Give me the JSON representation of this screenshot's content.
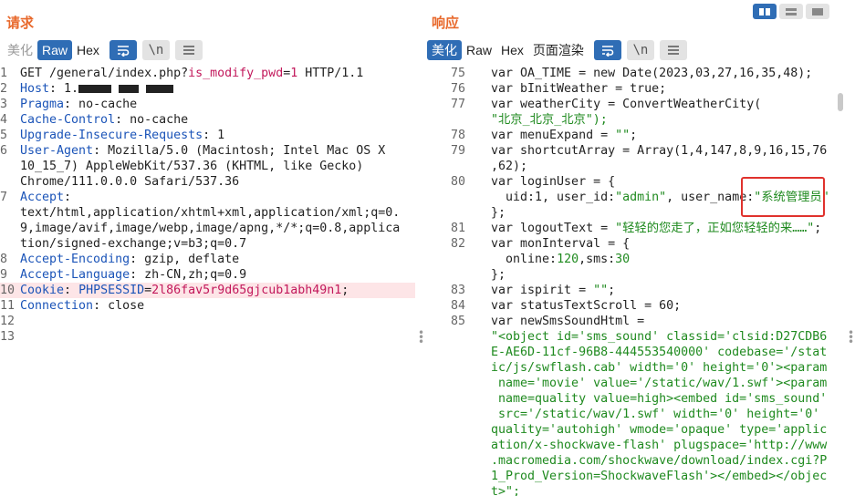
{
  "request": {
    "title": "请求",
    "tabs": [
      "美化",
      "Raw",
      "Hex"
    ],
    "active_tab": "Raw",
    "newline_label": "\\n",
    "lines": [
      {
        "n": "1",
        "parts": [
          {
            "t": "GET /general/index.php?",
            "c": "txt0"
          },
          {
            "t": "is_modify_pwd",
            "c": "v"
          },
          {
            "t": "=",
            "c": "txt0"
          },
          {
            "t": "1",
            "c": "v"
          },
          {
            "t": " HTTP/1.1",
            "c": "txt0"
          }
        ]
      },
      {
        "n": "2",
        "parts": [
          {
            "t": "Host",
            "c": "k"
          },
          {
            "t": ": ",
            "c": "txt0"
          },
          {
            "t": "1.",
            "c": "txt0"
          },
          {
            "mask": 36
          },
          {
            "t": " ",
            "c": "txt0"
          },
          {
            "mask": 22
          },
          {
            "t": " ",
            "c": "txt0"
          },
          {
            "mask": 30
          }
        ]
      },
      {
        "n": "3",
        "parts": [
          {
            "t": "Pragma",
            "c": "k"
          },
          {
            "t": ": no-cache",
            "c": "txt0"
          }
        ]
      },
      {
        "n": "4",
        "parts": [
          {
            "t": "Cache-Control",
            "c": "k"
          },
          {
            "t": ": no-cache",
            "c": "txt0"
          }
        ]
      },
      {
        "n": "5",
        "parts": [
          {
            "t": "Upgrade-Insecure-Requests",
            "c": "k"
          },
          {
            "t": ": 1",
            "c": "txt0"
          }
        ]
      },
      {
        "n": "6",
        "parts": [
          {
            "t": "User-Agent",
            "c": "k"
          },
          {
            "t": ": Mozilla/5.0 (Macintosh; Intel Mac OS X",
            "c": "txt0"
          }
        ]
      },
      {
        "n": "",
        "parts": [
          {
            "t": "10_15_7) AppleWebKit/537.36 (KHTML, like Gecko)",
            "c": "txt0"
          }
        ]
      },
      {
        "n": "",
        "parts": [
          {
            "t": "Chrome/111.0.0.0 Safari/537.36",
            "c": "txt0"
          }
        ]
      },
      {
        "n": "7",
        "parts": [
          {
            "t": "Accept",
            "c": "k"
          },
          {
            "t": ":",
            "c": "txt0"
          }
        ]
      },
      {
        "n": "",
        "parts": [
          {
            "t": "text/html,application/xhtml+xml,application/xml;q=0.",
            "c": "txt0"
          }
        ]
      },
      {
        "n": "",
        "parts": [
          {
            "t": "9,image/avif,image/webp,image/apng,*/*;q=0.8,applica",
            "c": "txt0"
          }
        ]
      },
      {
        "n": "",
        "parts": [
          {
            "t": "tion/signed-exchange;v=b3;q=0.7",
            "c": "txt0"
          }
        ]
      },
      {
        "n": "8",
        "parts": [
          {
            "t": "Accept-Encoding",
            "c": "k"
          },
          {
            "t": ": gzip, deflate",
            "c": "txt0"
          }
        ]
      },
      {
        "n": "9",
        "parts": [
          {
            "t": "Accept-Language",
            "c": "k"
          },
          {
            "t": ": zh-CN,zh;q=0.9",
            "c": "txt0"
          }
        ]
      },
      {
        "n": "10",
        "cur": true,
        "parts": [
          {
            "t": "Cookie",
            "c": "k"
          },
          {
            "t": ": ",
            "c": "txt0"
          },
          {
            "t": "PHPSESSID",
            "c": "k"
          },
          {
            "t": "=",
            "c": "txt0"
          },
          {
            "t": "2l86fav5r9d65gjcub1abh49n1",
            "c": "v"
          },
          {
            "t": ";",
            "c": "txt0"
          }
        ]
      },
      {
        "n": "11",
        "parts": [
          {
            "t": "Connection",
            "c": "k"
          },
          {
            "t": ": close",
            "c": "txt0"
          }
        ]
      },
      {
        "n": "12",
        "parts": []
      },
      {
        "n": "13",
        "parts": []
      }
    ]
  },
  "response": {
    "title": "响应",
    "tabs": [
      "美化",
      "Raw",
      "Hex",
      "页面渲染"
    ],
    "active_tab": "美化",
    "newline_label": "\\n",
    "lines": [
      {
        "n": "75",
        "parts": [
          {
            "t": "var OA_TIME = new Date(2023,03,27,16,35,48);",
            "c": "txt0"
          }
        ]
      },
      {
        "n": "76",
        "parts": [
          {
            "t": "var bInitWeather = true;",
            "c": "txt0"
          }
        ]
      },
      {
        "n": "77",
        "parts": [
          {
            "t": "var weatherCity = ConvertWeatherCity(",
            "c": "txt0"
          }
        ]
      },
      {
        "n": "",
        "parts": [
          {
            "t": "\"北京_北京_北京\");",
            "c": "s"
          }
        ]
      },
      {
        "n": "78",
        "parts": [
          {
            "t": "var menuExpand = ",
            "c": "txt0"
          },
          {
            "t": "\"\"",
            "c": "s"
          },
          {
            "t": ";",
            "c": "txt0"
          }
        ]
      },
      {
        "n": "79",
        "parts": [
          {
            "t": "var shortcutArray = Array(1,4,147,8,9,16,15,76",
            "c": "txt0"
          }
        ]
      },
      {
        "n": "",
        "parts": [
          {
            "t": ",62);",
            "c": "txt0"
          }
        ]
      },
      {
        "n": "80",
        "parts": [
          {
            "t": "var loginUser = {",
            "c": "txt0"
          }
        ]
      },
      {
        "n": "",
        "parts": [
          {
            "t": "  uid:1, user_id:",
            "c": "txt0"
          },
          {
            "t": "\"admin\"",
            "c": "s"
          },
          {
            "t": ", user_name:",
            "c": "txt0"
          },
          {
            "t": "\"系统管理员\"",
            "c": "s"
          }
        ]
      },
      {
        "n": "",
        "parts": [
          {
            "t": "};",
            "c": "txt0"
          }
        ]
      },
      {
        "n": "81",
        "parts": [
          {
            "t": "var logoutText = ",
            "c": "txt0"
          },
          {
            "t": "\"轻轻的您走了，正如您轻轻的来……\"",
            "c": "s"
          },
          {
            "t": ";",
            "c": "txt0"
          }
        ]
      },
      {
        "n": "82",
        "parts": [
          {
            "t": "var monInterval = {",
            "c": "txt0"
          }
        ]
      },
      {
        "n": "",
        "parts": [
          {
            "t": "  online:",
            "c": "txt0"
          },
          {
            "t": "120",
            "c": "s"
          },
          {
            "t": ",sms:",
            "c": "txt0"
          },
          {
            "t": "30",
            "c": "s"
          }
        ]
      },
      {
        "n": "",
        "parts": [
          {
            "t": "};",
            "c": "txt0"
          }
        ]
      },
      {
        "n": "83",
        "parts": [
          {
            "t": "var ispirit = ",
            "c": "txt0"
          },
          {
            "t": "\"\"",
            "c": "s"
          },
          {
            "t": ";",
            "c": "txt0"
          }
        ]
      },
      {
        "n": "84",
        "parts": [
          {
            "t": "var statusTextScroll = 60;",
            "c": "txt0"
          }
        ]
      },
      {
        "n": "85",
        "parts": [
          {
            "t": "var newSmsSoundHtml =",
            "c": "txt0"
          }
        ]
      },
      {
        "n": "",
        "parts": [
          {
            "t": "\"<object id='sms_sound' classid='clsid:D27CDB6",
            "c": "s"
          }
        ]
      },
      {
        "n": "",
        "parts": [
          {
            "t": "E-AE6D-11cf-96B8-444553540000' codebase='/stat",
            "c": "s"
          }
        ]
      },
      {
        "n": "",
        "parts": [
          {
            "t": "ic/js/swflash.cab' width='0' height='0'><param",
            "c": "s"
          }
        ]
      },
      {
        "n": "",
        "parts": [
          {
            "t": " name='movie' value='/static/wav/1.swf'><param",
            "c": "s"
          }
        ]
      },
      {
        "n": "",
        "parts": [
          {
            "t": " name=quality value=high><embed id='sms_sound'",
            "c": "s"
          }
        ]
      },
      {
        "n": "",
        "parts": [
          {
            "t": " src='/static/wav/1.swf' width='0' height='0'",
            "c": "s"
          }
        ]
      },
      {
        "n": "",
        "parts": [
          {
            "t": "quality='autohigh' wmode='opaque' type='applic",
            "c": "s"
          }
        ]
      },
      {
        "n": "",
        "parts": [
          {
            "t": "ation/x-shockwave-flash' plugspace='http://www",
            "c": "s"
          }
        ]
      },
      {
        "n": "",
        "parts": [
          {
            "t": ".macromedia.com/shockwave/download/index.cgi?P",
            "c": "s"
          }
        ]
      },
      {
        "n": "",
        "parts": [
          {
            "t": "1_Prod_Version=ShockwaveFlash'></embed></objec",
            "c": "s"
          }
        ]
      },
      {
        "n": "",
        "parts": [
          {
            "t": "t>\";",
            "c": "s"
          }
        ]
      }
    ]
  },
  "colors": {
    "accent": "#2f6db5",
    "title": "#e8692c",
    "header_key": "#1b54b8",
    "param_value": "#c2185b",
    "string": "#1f8a1f",
    "highlight_box": "#e0322d"
  },
  "icons": [
    "wrap-lines-icon",
    "menu-icon",
    "view-split-icon",
    "view-horizontal-icon",
    "view-single-icon"
  ]
}
